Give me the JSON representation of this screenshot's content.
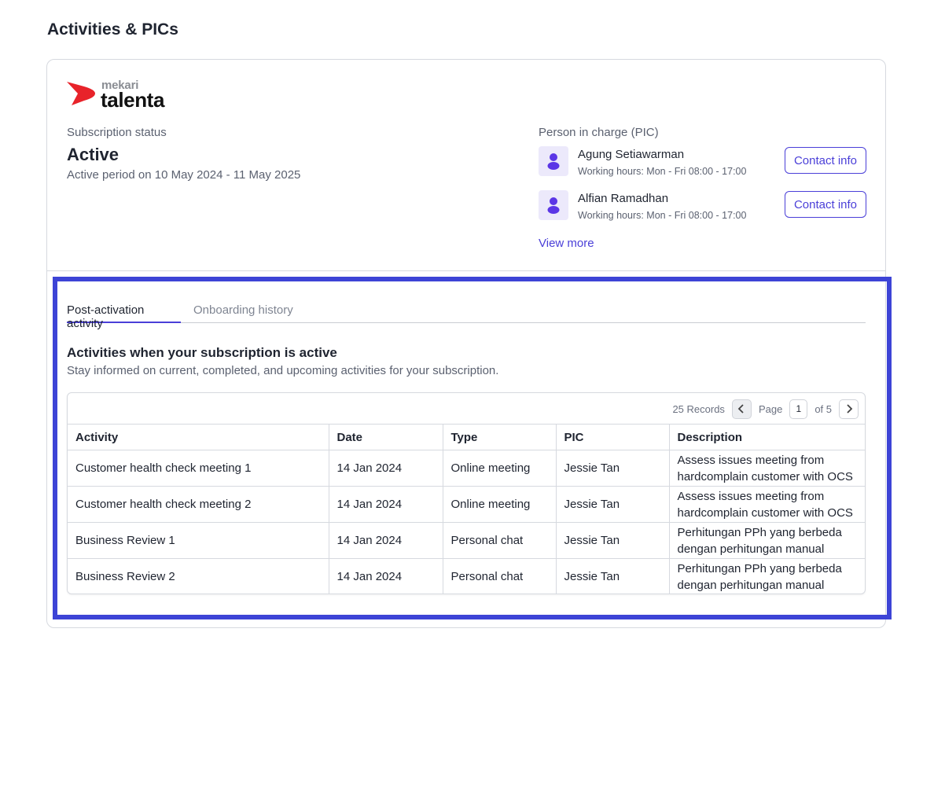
{
  "page": {
    "title": "Activities & PICs"
  },
  "brand": {
    "small": "mekari",
    "name": "talenta",
    "color": "#e8232a"
  },
  "subscription": {
    "label": "Subscription status",
    "status": "Active",
    "period": "Active period on 10 May 2024 - 11 May 2025"
  },
  "pic": {
    "label": "Person in charge (PIC)",
    "people": [
      {
        "name": "Agung Setiawarman",
        "hours": "Working hours: Mon - Fri 08:00 - 17:00",
        "button": "Contact info"
      },
      {
        "name": "Alfian Ramadhan",
        "hours": "Working hours: Mon - Fri 08:00 - 17:00",
        "button": "Contact info"
      }
    ],
    "view_more": "View more"
  },
  "tabs": [
    {
      "label": "Post-activation activity",
      "active": true
    },
    {
      "label": "Onboarding history",
      "active": false
    }
  ],
  "section": {
    "title": "Activities when your subscription is active",
    "description": "Stay informed on current, completed, and upcoming activities for your subscription."
  },
  "pagination": {
    "records": "25 Records",
    "page_label": "Page",
    "current": "1",
    "of": "of 5"
  },
  "table": {
    "headers": [
      "Activity",
      "Date",
      "Type",
      "PIC",
      "Description"
    ],
    "rows": [
      [
        "Customer health check meeting 1",
        "14 Jan 2024",
        "Online meeting",
        "Jessie Tan",
        "Assess issues meeting from hardcomplain customer with OCS"
      ],
      [
        "Customer health check meeting 2",
        "14 Jan 2024",
        "Online meeting",
        "Jessie Tan",
        "Assess issues meeting from hardcomplain customer with OCS"
      ],
      [
        "Business Review 1",
        "14 Jan 2024",
        "Personal chat",
        "Jessie Tan",
        "Perhitungan PPh yang berbeda dengan perhitungan manual"
      ],
      [
        "Business Review 2",
        "14 Jan 2024",
        "Personal chat",
        "Jessie Tan",
        "Perhitungan PPh yang berbeda dengan perhitungan manual"
      ]
    ]
  },
  "colors": {
    "accent": "#4a3fd8",
    "highlight": "#3d44d6"
  }
}
